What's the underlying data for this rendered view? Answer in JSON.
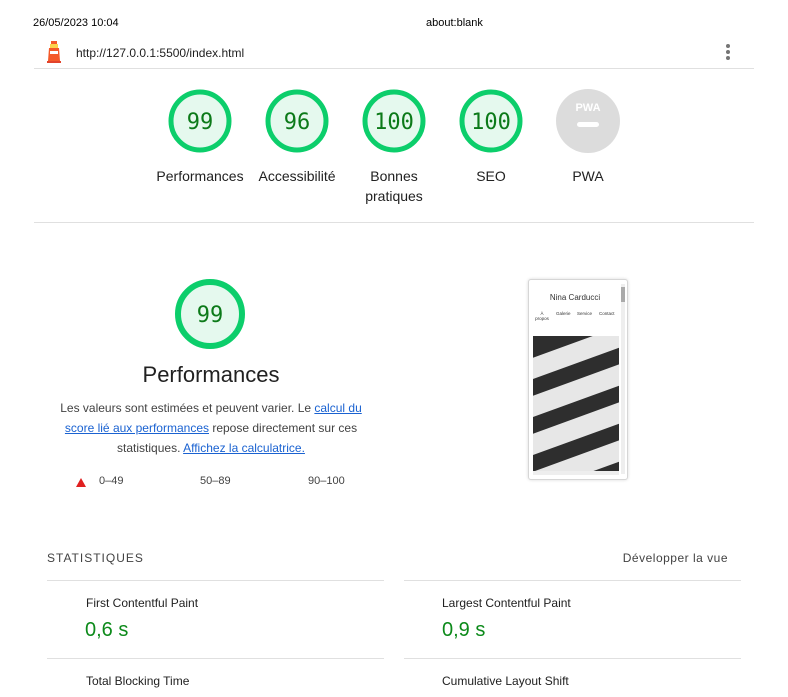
{
  "print_header": {
    "date": "26/05/2023 10:04",
    "url": "about:blank"
  },
  "topbar": {
    "url": "http://127.0.0.1:5500/index.html",
    "menu_icon": "kebab-menu-icon"
  },
  "colors": {
    "pass": "#0cce6b",
    "pass_fill": "#e5f9ee",
    "pass_text": "#0c7a19",
    "na": "#dcdcdc",
    "fail": "#e02020",
    "link": "#1a62d1"
  },
  "gauges": [
    {
      "score": "99",
      "label": "Performances"
    },
    {
      "score": "96",
      "label": "Accessibilité"
    },
    {
      "score": "100",
      "label_line1": "Bonnes",
      "label_line2": "pratiques"
    },
    {
      "score": "100",
      "label": "SEO"
    },
    {
      "badge": "PWA",
      "label": "PWA"
    }
  ],
  "performance": {
    "score": "99",
    "title": "Performances",
    "desc_part1": "Les valeurs sont estimées et peuvent varier. Le ",
    "desc_link1": "calcul du score lié aux performances",
    "desc_part2": " repose directement sur ces statistiques. ",
    "desc_link2": "Affichez la calculatrice.",
    "legend": {
      "fail": "0–49",
      "average": "50–89",
      "pass": "90–100"
    }
  },
  "screenshot": {
    "site_title": "Nina Carducci",
    "nav": [
      "À propos",
      "Galerie",
      "Service",
      "Contact"
    ]
  },
  "statistics": {
    "heading": "STATISTIQUES",
    "expand_label": "Développer la vue",
    "metrics": [
      {
        "name": "First Contentful Paint",
        "value": "0,6 s"
      },
      {
        "name": "Largest Contentful Paint",
        "value": "0,9 s"
      },
      {
        "name": "Total Blocking Time",
        "value": ""
      },
      {
        "name": "Cumulative Layout Shift",
        "value": ""
      }
    ]
  }
}
